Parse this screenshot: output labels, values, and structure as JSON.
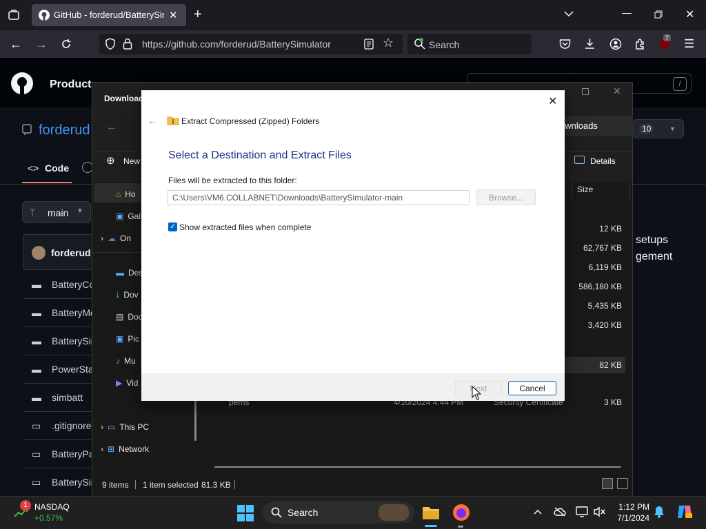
{
  "browser": {
    "tab_title": "GitHub - forderud/BatterySimu",
    "url": "https://github.com/forderud/BatterySimulator",
    "search_placeholder": "Search",
    "extensions_badge": "7"
  },
  "github": {
    "nav_product": "Product",
    "repo_owner": "forderud",
    "code_tab": "Code",
    "branch": "main",
    "latest_commit_user": "forderud",
    "files": [
      "BatteryCo",
      "BatteryMo",
      "BatterySin",
      "PowerStat",
      "simbatt",
      ".gitignore",
      "BatteryPa",
      "BatterySin"
    ],
    "about_line1": "setups",
    "about_line2": "gement",
    "counter": "10"
  },
  "explorer": {
    "title": "Download",
    "breadcrumb_tail": "ownloads",
    "new_label": "New",
    "details_label": "Details",
    "size_header": "Size",
    "sizes": [
      "12 KB",
      "62,767 KB",
      "6,119 KB",
      "586,180 KB",
      "5,435 KB",
      "3,420 KB",
      "82 KB",
      "3 KB"
    ],
    "last_row": {
      "name": "pems",
      "date": "4/10/2024 4:44 PM",
      "type": "Security Certificate"
    },
    "sidebar": [
      {
        "label": "Ho",
        "icon": "home-icon"
      },
      {
        "label": "Gal",
        "icon": "gallery-icon"
      },
      {
        "label": "On",
        "icon": "onedrive-icon"
      },
      {
        "label": "Des",
        "icon": "desktop-icon"
      },
      {
        "label": "Dov",
        "icon": "download-icon"
      },
      {
        "label": "Doc",
        "icon": "document-icon"
      },
      {
        "label": "Pic",
        "icon": "pictures-icon"
      },
      {
        "label": "Mu",
        "icon": "music-icon"
      },
      {
        "label": "Vid",
        "icon": "video-icon"
      },
      {
        "label": "This PC",
        "icon": "pc-icon"
      },
      {
        "label": "Network",
        "icon": "network-icon"
      }
    ],
    "status": {
      "items": "9 items",
      "selected": "1 item selected",
      "size": "81.3 KB"
    }
  },
  "dialog": {
    "title": "Extract Compressed (Zipped) Folders",
    "heading": "Select a Destination and Extract Files",
    "path_label": "Files will be extracted to this folder:",
    "path_value": "C:\\Users\\VM6.COLLABNET\\Downloads\\BatterySimulator-main",
    "browse_label": "Browse...",
    "checkbox_label": "Show extracted files when complete",
    "checkbox_checked": true,
    "next_label": "Next",
    "cancel_label": "Cancel",
    "accent_color": "#0067c0",
    "heading_color": "#1e3287"
  },
  "taskbar": {
    "ticker_name": "NASDAQ",
    "ticker_change": "+0.57%",
    "ticker_badge": "1",
    "search_label": "Search",
    "time": "1:12 PM",
    "date": "7/1/2024"
  }
}
